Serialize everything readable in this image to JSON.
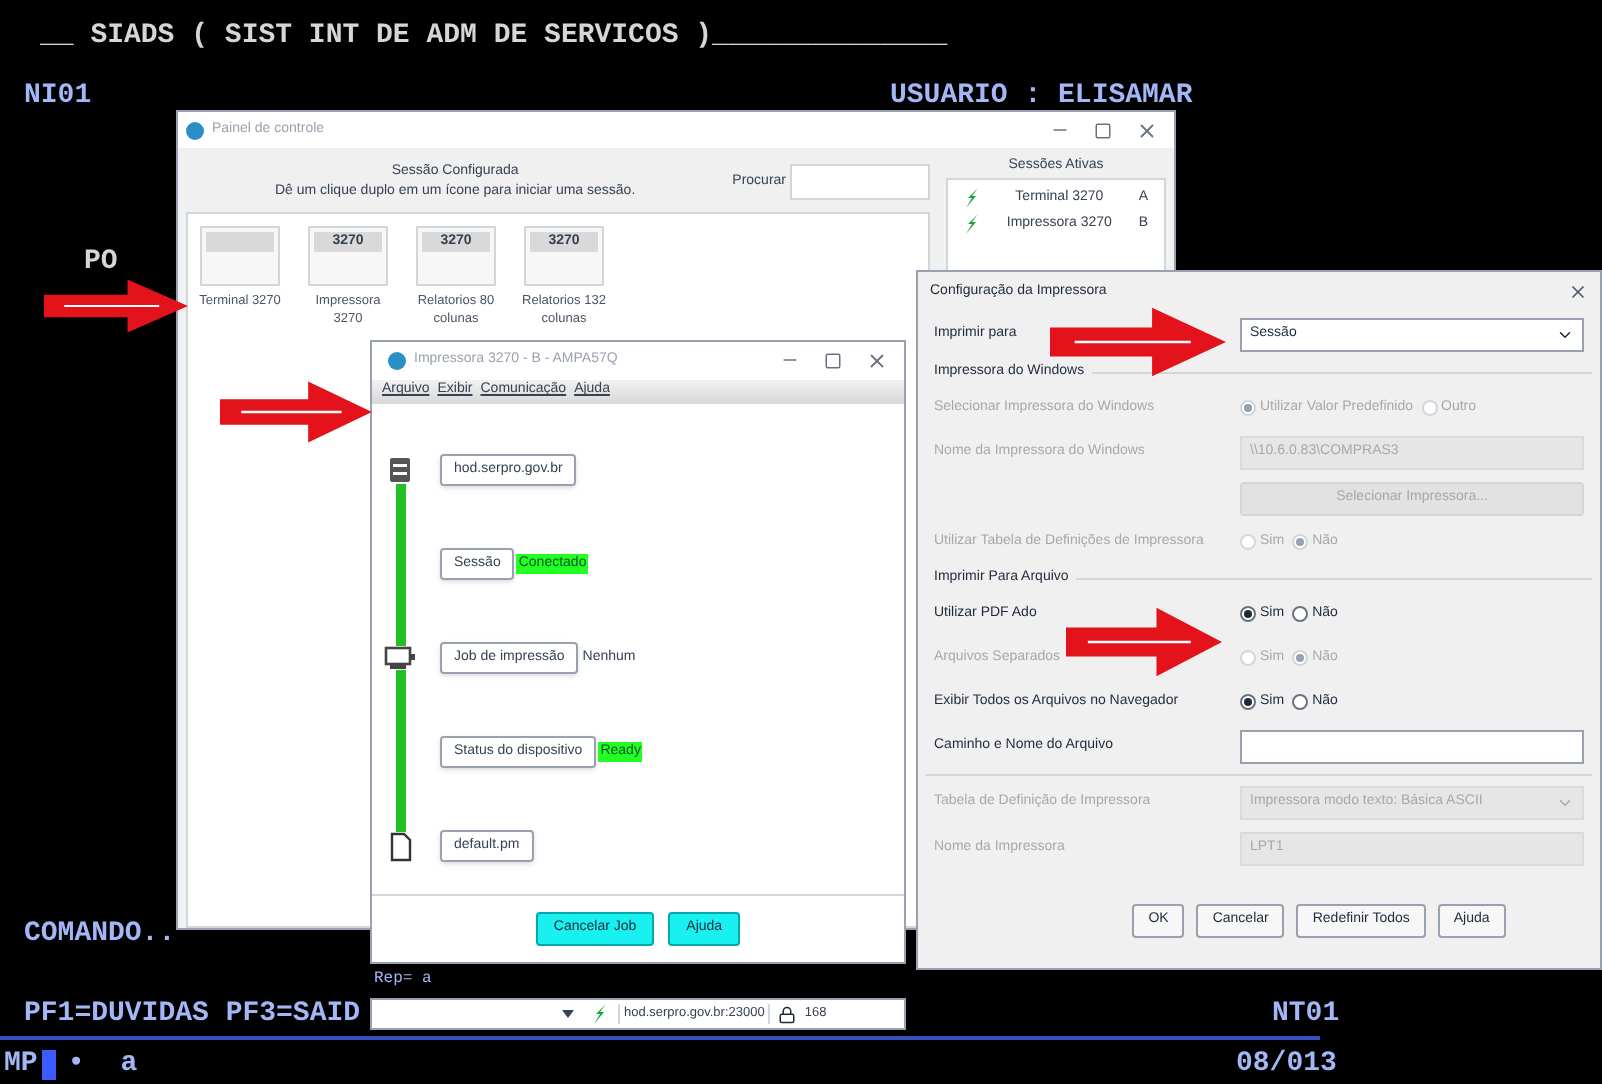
{
  "terminal": {
    "title": "__ SIADS ( SIST INT DE ADM DE SERVICOS )______________",
    "system_id": "NI01",
    "user": "USUARIO : ELISAMAR",
    "field_label": "PO",
    "command_label": "COMANDO..",
    "function_keys": "PF1=DUVIDAS PF3=SAID",
    "terminal_id": "NT01",
    "status_left": "MP",
    "status_bullet": "•",
    "status_mark": "a",
    "caption": "Rep= a",
    "position": "08/013"
  },
  "control_panel": {
    "title": "Painel de controle",
    "heading": "Sessão Configurada",
    "hint": "Dê um clique duplo em um ícone para iniciar uma sessão.",
    "search_label": "Procurar",
    "sessions": [
      {
        "label": "Terminal 3270"
      },
      {
        "badge": "3270",
        "label": "Impressora 3270"
      },
      {
        "badge": "3270",
        "label": "Relatorios 80 colunas"
      },
      {
        "badge": "3270",
        "label": "Relatorios 132 colunas"
      }
    ],
    "active_title": "Sessões Ativas",
    "active_sessions": [
      {
        "name": "Terminal 3270",
        "letter": "A"
      },
      {
        "name": "Impressora 3270",
        "letter": "B"
      }
    ]
  },
  "printer_window": {
    "title": "Impressora 3270 - B - AMPA57Q",
    "menu": [
      "Arquivo",
      "Exibir",
      "Comunicação",
      "Ajuda"
    ],
    "steps": [
      {
        "kind": "server",
        "label": "hod.serpro.gov.br"
      },
      {
        "kind": "link",
        "label": "Sessão",
        "status": "Conectado",
        "highlight": true
      },
      {
        "kind": "printer",
        "label": "Job de impressão",
        "status": "Nenhum",
        "highlight": false
      },
      {
        "kind": "link",
        "label": "Status do dispositivo",
        "status": "Ready",
        "highlight": true
      },
      {
        "kind": "document",
        "label": "default.pm"
      }
    ],
    "buttons": [
      "Cancelar Job",
      "Ajuda"
    ],
    "status_bar": {
      "host": "hod.serpro.gov.br:23000",
      "code": "168"
    }
  },
  "config": {
    "title": "Configuração da Impressora",
    "rows": [
      {
        "kind": "select",
        "label": "Imprimir para",
        "value": "Sessão",
        "disabled": false
      },
      {
        "kind": "section",
        "label": "Impressora do Windows"
      },
      {
        "kind": "radio",
        "label": "Selecionar Impressora do Windows",
        "disabled": true,
        "options": [
          {
            "label": "Utilizar Valor Predefinido",
            "selected": true
          },
          {
            "label": "Outro",
            "selected": false
          }
        ]
      },
      {
        "kind": "field",
        "label": "Nome da Impressora do Windows",
        "value": "\\\\10.6.0.83\\COMPRAS3",
        "disabled": true
      },
      {
        "kind": "button",
        "label": "Selecionar Impressora...",
        "disabled": true
      },
      {
        "kind": "radio",
        "label": "Utilizar Tabela de Definições de Impressora",
        "disabled": true,
        "options": [
          {
            "label": "Sim",
            "selected": false
          },
          {
            "label": "Não",
            "selected": true
          }
        ]
      },
      {
        "kind": "section",
        "label": "Imprimir Para Arquivo"
      },
      {
        "kind": "radio",
        "label": "Utilizar PDF Ado",
        "disabled": false,
        "options": [
          {
            "label": "Sim",
            "selected": true
          },
          {
            "label": "Não",
            "selected": false
          }
        ]
      },
      {
        "kind": "radio",
        "label": "Arquivos Separados",
        "disabled": true,
        "options": [
          {
            "label": "Sim",
            "selected": false
          },
          {
            "label": "Não",
            "selected": true
          }
        ]
      },
      {
        "kind": "radio",
        "label": "Exibir Todos os Arquivos no Navegador",
        "disabled": false,
        "options": [
          {
            "label": "Sim",
            "selected": true
          },
          {
            "label": "Não",
            "selected": false
          }
        ]
      },
      {
        "kind": "field",
        "label": "Caminho e Nome do Arquivo",
        "disabled": false
      },
      {
        "kind": "divider"
      },
      {
        "kind": "select",
        "label": "Tabela de Definição de Impressora",
        "value": "Impressora modo texto: Básica ASCII",
        "disabled": true
      },
      {
        "kind": "field",
        "label": "Nome da Impressora",
        "value": "LPT1",
        "disabled": true
      }
    ],
    "buttons": [
      "OK",
      "Cancelar",
      "Redefinir Todos",
      "Ajuda"
    ]
  }
}
